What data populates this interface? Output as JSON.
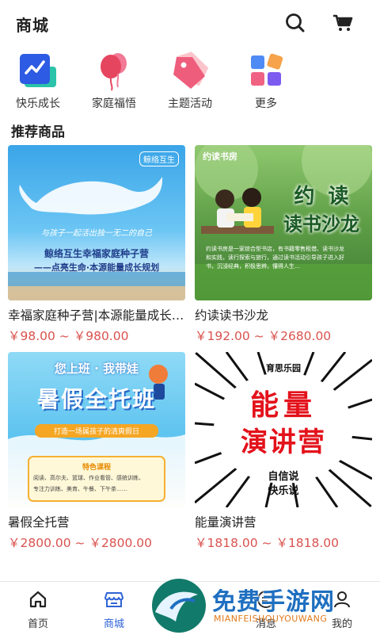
{
  "header": {
    "title": "商城",
    "search_icon": "search-icon",
    "cart_icon": "cart-icon"
  },
  "categories": [
    {
      "label": "快乐成长",
      "icon": "growth-chart-icon"
    },
    {
      "label": "家庭福悟",
      "icon": "balloon-icon"
    },
    {
      "label": "主题活动",
      "icon": "tag-icon"
    },
    {
      "label": "更多",
      "icon": "grid-more-icon"
    }
  ],
  "section_title": "推荐商品",
  "products": [
    {
      "name": "幸福家庭种子营|本源能量成长规划",
      "price": "￥98.00 ~ ￥980.00",
      "image": {
        "badge": "鲸络互生",
        "slogan": "与孩子一起活出独一无二的自己",
        "line1": "鲸络互生幸福家庭种子营",
        "line2": "——点亮生命·本源能量成长规划"
      }
    },
    {
      "name": "约读读书沙龙",
      "price": "￥192.00 ~ ￥2680.00",
      "image": {
        "badge": "约读书房",
        "line1": "约 读",
        "line2": "读书沙龙",
        "desc": "约读书房是一家综合型书店，有书籍零售租借、读书沙龙和实践，读行探索与旅行，通过读书活动引导孩子进入好书，沉浸经典，积极思辨，懂得人生…"
      }
    },
    {
      "name": "暑假全托营",
      "price": "￥2800.00 ~ ￥2800.00",
      "image": {
        "top": "您上班 · 我带娃",
        "main": "暑假全托班",
        "ribbon": "打造一场属孩子的清爽假日",
        "box_title": "特色课程",
        "box_line1": "阅读、高尔夫、篮球、作业看管、感统训练、",
        "box_line2": "专注力训练、美育、午餐、下午茶……"
      }
    },
    {
      "name": "能量演讲营",
      "price": "￥1818.00 ~ ￥1818.00",
      "image": {
        "top": "育思乐园",
        "line1": "能量",
        "line2": "演讲营",
        "sub1": "自信说",
        "sub2": "快乐说"
      }
    }
  ],
  "tabbar": [
    {
      "label": "首页",
      "icon": "home-icon",
      "active": false
    },
    {
      "label": "商城",
      "icon": "store-icon",
      "active": true
    },
    {
      "label": "消息",
      "icon": "message-icon",
      "active": false
    },
    {
      "label": "我的",
      "icon": "user-icon",
      "active": false
    }
  ],
  "watermark": {
    "text": "免费手游网",
    "sub": "MIANFEISHOUYOUWANG"
  },
  "colors": {
    "accent": "#2f63d6",
    "price": "#d9534f"
  }
}
